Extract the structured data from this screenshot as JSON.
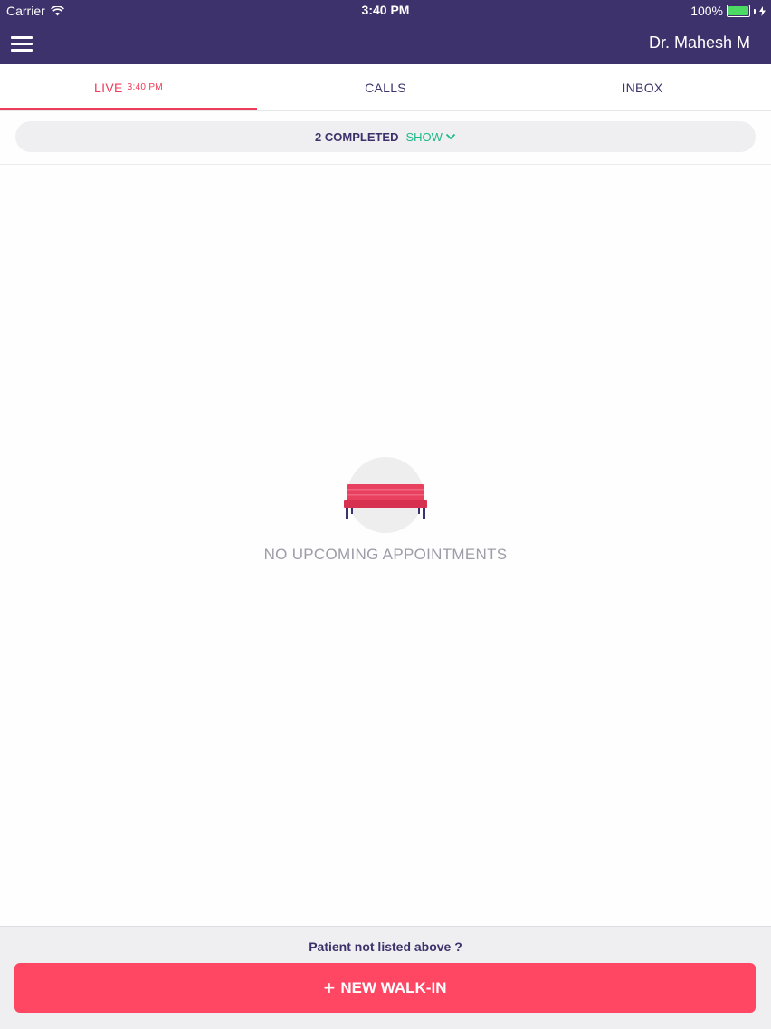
{
  "status_bar": {
    "carrier": "Carrier",
    "time": "3:40 PM",
    "battery": "100%"
  },
  "header": {
    "user_name": "Dr. Mahesh M"
  },
  "tabs": [
    {
      "label": "LIVE",
      "time": "3:40 PM",
      "active": true
    },
    {
      "label": "CALLS"
    },
    {
      "label": "INBOX"
    }
  ],
  "completed": {
    "text": "2 COMPLETED",
    "show_label": "SHOW"
  },
  "empty_state": {
    "message": "NO UPCOMING APPOINTMENTS",
    "icon": "bench-icon"
  },
  "footer": {
    "prompt": "Patient not listed above ?",
    "button_label": "NEW WALK-IN",
    "button_icon": "plus-icon"
  },
  "colors": {
    "header_bg": "#3d326b",
    "accent": "#ee3d5a",
    "button_bg": "#ff4663",
    "show_link": "#1bb98a",
    "muted_text": "#9d9ca8"
  }
}
